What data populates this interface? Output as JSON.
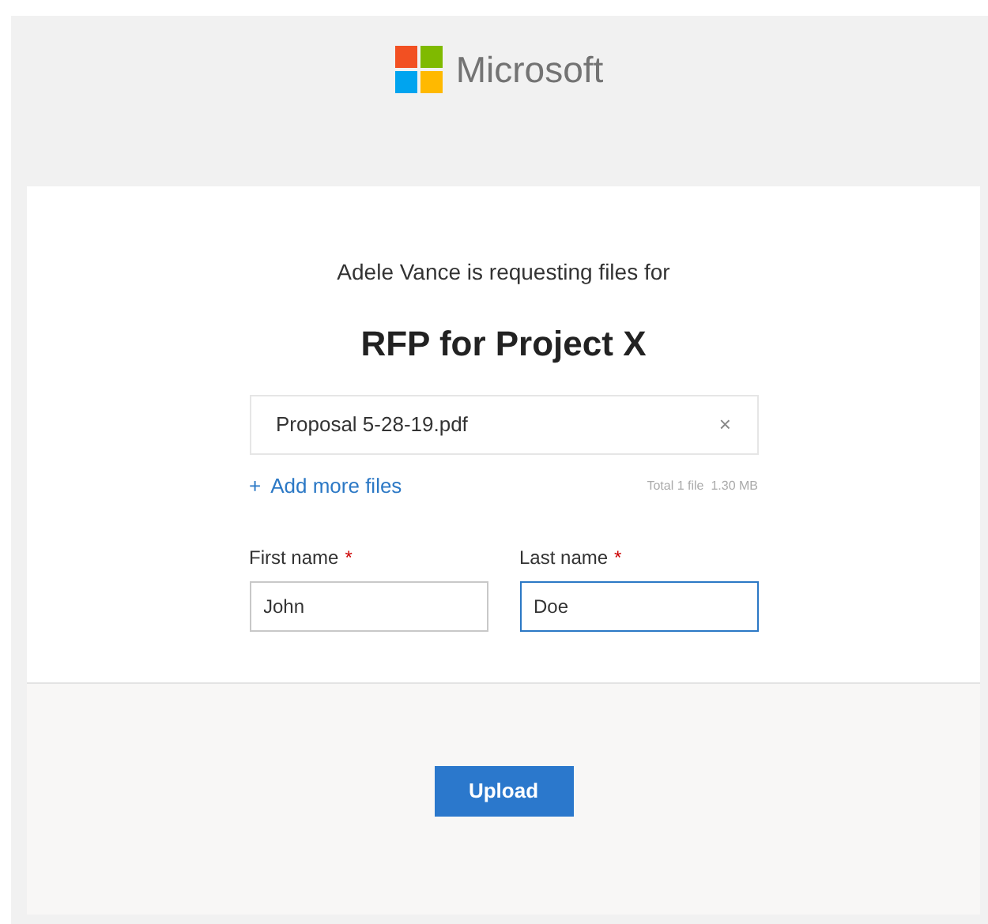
{
  "header": {
    "brand": "Microsoft"
  },
  "request": {
    "message": "Adele Vance is requesting files for",
    "title": "RFP for Project X"
  },
  "files": [
    {
      "name": "Proposal 5-28-19.pdf",
      "remove": "×"
    }
  ],
  "add_more": {
    "icon": "+",
    "label": "Add more files"
  },
  "total": "Total 1 file  1.30 MB",
  "fields": [
    {
      "label": "First name",
      "required_mark": "*",
      "value": "John",
      "focused": false
    },
    {
      "label": "Last name",
      "required_mark": "*",
      "value": "Doe",
      "focused": true
    }
  ],
  "button": "Upload"
}
